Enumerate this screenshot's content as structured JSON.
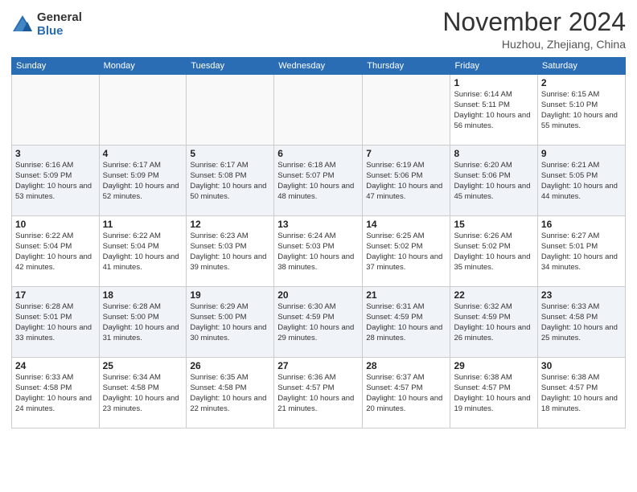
{
  "header": {
    "logo_general": "General",
    "logo_blue": "Blue",
    "month": "November 2024",
    "location": "Huzhou, Zhejiang, China"
  },
  "weekdays": [
    "Sunday",
    "Monday",
    "Tuesday",
    "Wednesday",
    "Thursday",
    "Friday",
    "Saturday"
  ],
  "weeks": [
    [
      {
        "day": "",
        "info": ""
      },
      {
        "day": "",
        "info": ""
      },
      {
        "day": "",
        "info": ""
      },
      {
        "day": "",
        "info": ""
      },
      {
        "day": "",
        "info": ""
      },
      {
        "day": "1",
        "info": "Sunrise: 6:14 AM\nSunset: 5:11 PM\nDaylight: 10 hours and 56 minutes."
      },
      {
        "day": "2",
        "info": "Sunrise: 6:15 AM\nSunset: 5:10 PM\nDaylight: 10 hours and 55 minutes."
      }
    ],
    [
      {
        "day": "3",
        "info": "Sunrise: 6:16 AM\nSunset: 5:09 PM\nDaylight: 10 hours and 53 minutes."
      },
      {
        "day": "4",
        "info": "Sunrise: 6:17 AM\nSunset: 5:09 PM\nDaylight: 10 hours and 52 minutes."
      },
      {
        "day": "5",
        "info": "Sunrise: 6:17 AM\nSunset: 5:08 PM\nDaylight: 10 hours and 50 minutes."
      },
      {
        "day": "6",
        "info": "Sunrise: 6:18 AM\nSunset: 5:07 PM\nDaylight: 10 hours and 48 minutes."
      },
      {
        "day": "7",
        "info": "Sunrise: 6:19 AM\nSunset: 5:06 PM\nDaylight: 10 hours and 47 minutes."
      },
      {
        "day": "8",
        "info": "Sunrise: 6:20 AM\nSunset: 5:06 PM\nDaylight: 10 hours and 45 minutes."
      },
      {
        "day": "9",
        "info": "Sunrise: 6:21 AM\nSunset: 5:05 PM\nDaylight: 10 hours and 44 minutes."
      }
    ],
    [
      {
        "day": "10",
        "info": "Sunrise: 6:22 AM\nSunset: 5:04 PM\nDaylight: 10 hours and 42 minutes."
      },
      {
        "day": "11",
        "info": "Sunrise: 6:22 AM\nSunset: 5:04 PM\nDaylight: 10 hours and 41 minutes."
      },
      {
        "day": "12",
        "info": "Sunrise: 6:23 AM\nSunset: 5:03 PM\nDaylight: 10 hours and 39 minutes."
      },
      {
        "day": "13",
        "info": "Sunrise: 6:24 AM\nSunset: 5:03 PM\nDaylight: 10 hours and 38 minutes."
      },
      {
        "day": "14",
        "info": "Sunrise: 6:25 AM\nSunset: 5:02 PM\nDaylight: 10 hours and 37 minutes."
      },
      {
        "day": "15",
        "info": "Sunrise: 6:26 AM\nSunset: 5:02 PM\nDaylight: 10 hours and 35 minutes."
      },
      {
        "day": "16",
        "info": "Sunrise: 6:27 AM\nSunset: 5:01 PM\nDaylight: 10 hours and 34 minutes."
      }
    ],
    [
      {
        "day": "17",
        "info": "Sunrise: 6:28 AM\nSunset: 5:01 PM\nDaylight: 10 hours and 33 minutes."
      },
      {
        "day": "18",
        "info": "Sunrise: 6:28 AM\nSunset: 5:00 PM\nDaylight: 10 hours and 31 minutes."
      },
      {
        "day": "19",
        "info": "Sunrise: 6:29 AM\nSunset: 5:00 PM\nDaylight: 10 hours and 30 minutes."
      },
      {
        "day": "20",
        "info": "Sunrise: 6:30 AM\nSunset: 4:59 PM\nDaylight: 10 hours and 29 minutes."
      },
      {
        "day": "21",
        "info": "Sunrise: 6:31 AM\nSunset: 4:59 PM\nDaylight: 10 hours and 28 minutes."
      },
      {
        "day": "22",
        "info": "Sunrise: 6:32 AM\nSunset: 4:59 PM\nDaylight: 10 hours and 26 minutes."
      },
      {
        "day": "23",
        "info": "Sunrise: 6:33 AM\nSunset: 4:58 PM\nDaylight: 10 hours and 25 minutes."
      }
    ],
    [
      {
        "day": "24",
        "info": "Sunrise: 6:33 AM\nSunset: 4:58 PM\nDaylight: 10 hours and 24 minutes."
      },
      {
        "day": "25",
        "info": "Sunrise: 6:34 AM\nSunset: 4:58 PM\nDaylight: 10 hours and 23 minutes."
      },
      {
        "day": "26",
        "info": "Sunrise: 6:35 AM\nSunset: 4:58 PM\nDaylight: 10 hours and 22 minutes."
      },
      {
        "day": "27",
        "info": "Sunrise: 6:36 AM\nSunset: 4:57 PM\nDaylight: 10 hours and 21 minutes."
      },
      {
        "day": "28",
        "info": "Sunrise: 6:37 AM\nSunset: 4:57 PM\nDaylight: 10 hours and 20 minutes."
      },
      {
        "day": "29",
        "info": "Sunrise: 6:38 AM\nSunset: 4:57 PM\nDaylight: 10 hours and 19 minutes."
      },
      {
        "day": "30",
        "info": "Sunrise: 6:38 AM\nSunset: 4:57 PM\nDaylight: 10 hours and 18 minutes."
      }
    ]
  ]
}
